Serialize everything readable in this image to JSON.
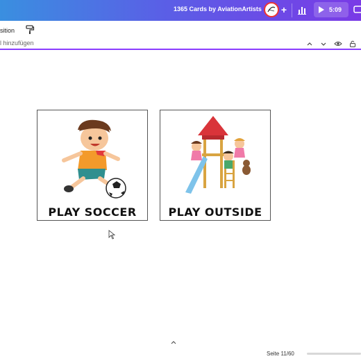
{
  "header": {
    "doc_title": "1365 Cards by AviationArtists",
    "add_label": "+",
    "present_time": "5:09"
  },
  "toolbar": {
    "position_label": "sition"
  },
  "titlebar": {
    "placeholder": "l hinzufügen"
  },
  "cards": [
    {
      "label": "PLAY SOCCER",
      "icon": "soccer-boy-illustration"
    },
    {
      "label": "PLAY OUTSIDE",
      "icon": "playground-illustration"
    }
  ],
  "footer": {
    "page_indicator": "Seite 11/60",
    "collapse_icon": "chevron-up-icon"
  },
  "colors": {
    "header_gradient_start": "#3a8fe0",
    "header_gradient_end": "#7a3ae6",
    "accent": "#8b3dff"
  }
}
